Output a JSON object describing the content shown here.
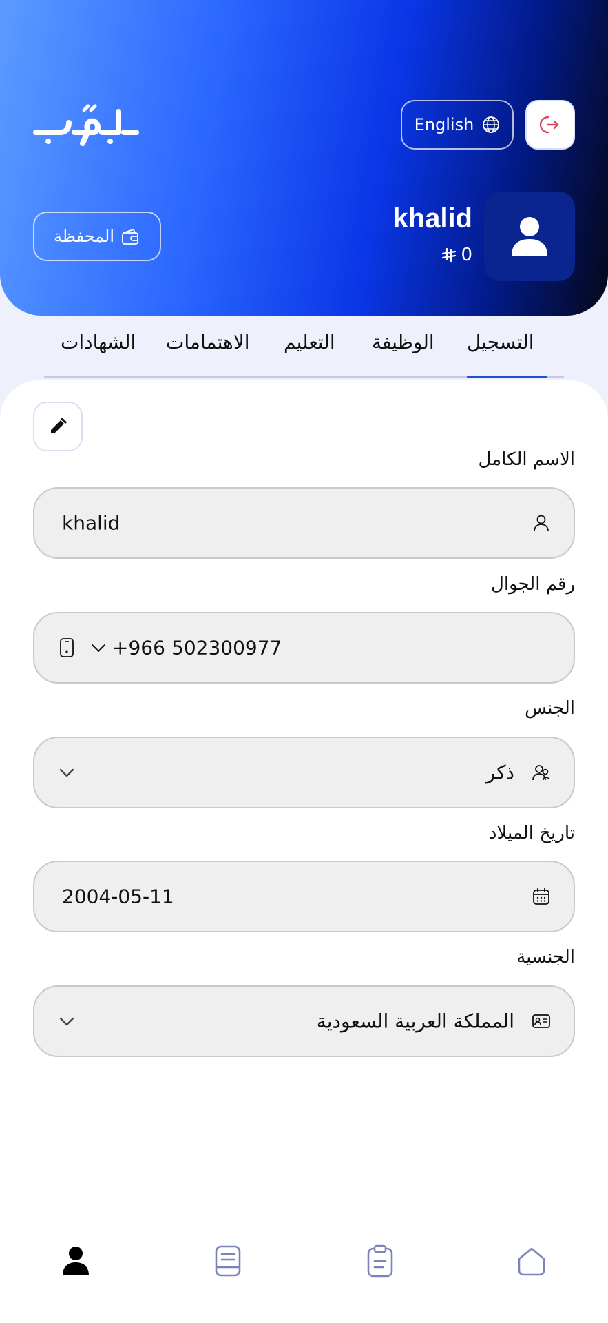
{
  "header": {
    "logo_text": "جوّاب",
    "language_label": "English",
    "user_name": "khalid",
    "balance": "0",
    "wallet_label": "المحفظة"
  },
  "tabs": [
    {
      "label": "التسجيل",
      "active": true
    },
    {
      "label": "الوظيفة",
      "active": false
    },
    {
      "label": "التعليم",
      "active": false
    },
    {
      "label": "الاهتمامات",
      "active": false
    },
    {
      "label": "الشهادات",
      "active": false
    }
  ],
  "form": {
    "full_name": {
      "label": "الاسم الكامل",
      "value": "khalid"
    },
    "mobile": {
      "label": "رقم الجوال",
      "country_code": "+966",
      "value": "502300977"
    },
    "gender": {
      "label": "الجنس",
      "value": "ذكر"
    },
    "birth_date": {
      "label": "تاريخ الميلاد",
      "value": "2004-05-11"
    },
    "nationality": {
      "label": "الجنسية",
      "value": "المملكة العربية السعودية"
    }
  },
  "colors": {
    "accent": "#1f4fd6",
    "exit_icon": "#e0455b",
    "nav_inactive": "#7a84b8"
  },
  "icons": {
    "exit": "logout-icon",
    "language": "globe-icon",
    "wallet": "wallet-icon",
    "avatar": "user-icon",
    "edit": "pencil-icon",
    "nav": [
      "profile-icon",
      "document-icon",
      "clipboard-icon",
      "home-icon"
    ]
  }
}
